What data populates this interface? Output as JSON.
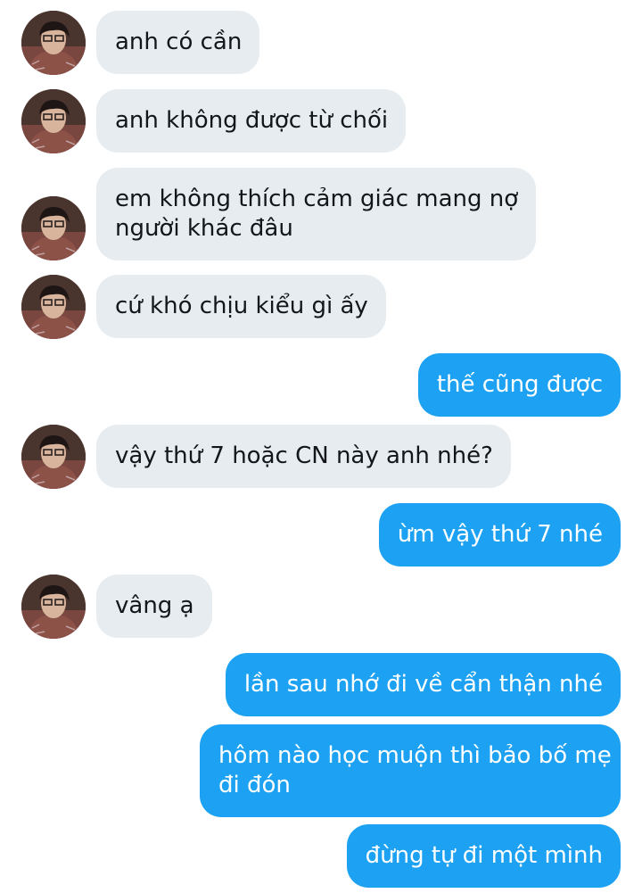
{
  "messages": [
    {
      "side": "in",
      "lines": [
        "anh có cần"
      ]
    },
    {
      "side": "in",
      "lines": [
        "anh không được từ chối"
      ]
    },
    {
      "side": "in",
      "lines": [
        "em không thích cảm giác mang nợ",
        "người khác đâu"
      ]
    },
    {
      "side": "in",
      "lines": [
        "cứ khó chịu kiểu gì ấy"
      ]
    },
    {
      "side": "out",
      "lines": [
        "thế cũng được"
      ]
    },
    {
      "side": "in",
      "lines": [
        "vậy thứ 7 hoặc CN này anh nhé?"
      ]
    },
    {
      "side": "out",
      "lines": [
        "ừm vậy thứ 7 nhé"
      ]
    },
    {
      "side": "in",
      "lines": [
        "vâng ạ"
      ]
    },
    {
      "side": "out",
      "lines": [
        "lần sau nhớ đi về cẩn thận nhé"
      ]
    },
    {
      "side": "out",
      "lines": [
        "hôm nào học muộn thì bảo bố mẹ",
        "đi đón"
      ]
    },
    {
      "side": "out",
      "lines": [
        "đừng tự đi một mình"
      ]
    }
  ],
  "colors": {
    "incoming_bubble": "#e6ecf0",
    "outgoing_bubble": "#1da1f2",
    "incoming_text": "#14171a",
    "outgoing_text": "#ffffff"
  },
  "icons": {
    "avatar": "contact-avatar-photo"
  }
}
